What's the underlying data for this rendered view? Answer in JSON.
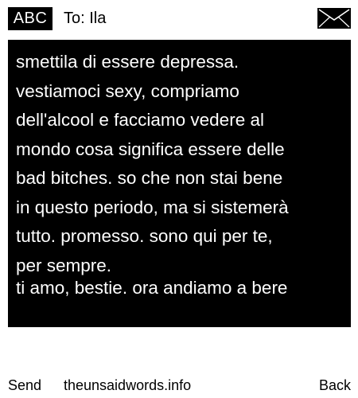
{
  "header": {
    "mode_label": "ABC",
    "recipient": "To: Ila",
    "status_icon": "envelope-icon"
  },
  "message": {
    "body": "smettila di essere depressa.\nvestiamoci sexy, compriamo\ndell'alcool e facciamo vedere al\nmondo cosa significa essere delle\nbad bitches. so che non stai bene\nin questo periodo, ma si sistemerà\ntutto. promesso. sono qui per te,\nper sempre.",
    "closing": "ti amo, bestie. ora andiamo a bere"
  },
  "footer": {
    "left_softkey": "Send",
    "site": "theunsaidwords.info",
    "right_softkey": "Back"
  },
  "colors": {
    "background": "#ffffff",
    "message_bg": "#000000",
    "message_text": "#ffffff",
    "text": "#000000"
  }
}
